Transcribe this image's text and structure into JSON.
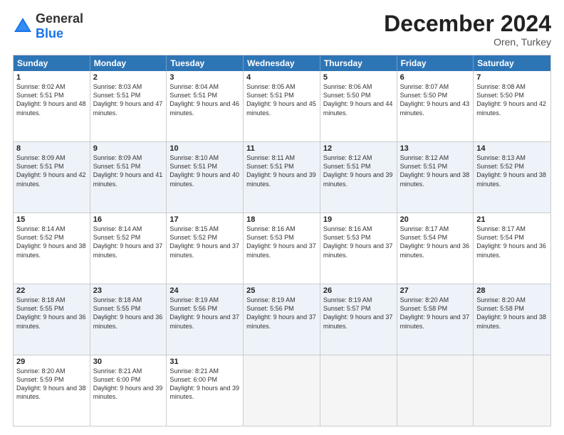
{
  "header": {
    "logo": {
      "general": "General",
      "blue": "Blue"
    },
    "title": "December 2024",
    "subtitle": "Oren, Turkey"
  },
  "days": [
    "Sunday",
    "Monday",
    "Tuesday",
    "Wednesday",
    "Thursday",
    "Friday",
    "Saturday"
  ],
  "weeks": [
    [
      {
        "day": "1",
        "rise": "8:02 AM",
        "set": "5:51 PM",
        "hours": "9 hours and 48 minutes."
      },
      {
        "day": "2",
        "rise": "8:03 AM",
        "set": "5:51 PM",
        "hours": "9 hours and 47 minutes."
      },
      {
        "day": "3",
        "rise": "8:04 AM",
        "set": "5:51 PM",
        "hours": "9 hours and 46 minutes."
      },
      {
        "day": "4",
        "rise": "8:05 AM",
        "set": "5:51 PM",
        "hours": "9 hours and 45 minutes."
      },
      {
        "day": "5",
        "rise": "8:06 AM",
        "set": "5:50 PM",
        "hours": "9 hours and 44 minutes."
      },
      {
        "day": "6",
        "rise": "8:07 AM",
        "set": "5:50 PM",
        "hours": "9 hours and 43 minutes."
      },
      {
        "day": "7",
        "rise": "8:08 AM",
        "set": "5:50 PM",
        "hours": "9 hours and 42 minutes."
      }
    ],
    [
      {
        "day": "8",
        "rise": "8:09 AM",
        "set": "5:51 PM",
        "hours": "9 hours and 42 minutes."
      },
      {
        "day": "9",
        "rise": "8:09 AM",
        "set": "5:51 PM",
        "hours": "9 hours and 41 minutes."
      },
      {
        "day": "10",
        "rise": "8:10 AM",
        "set": "5:51 PM",
        "hours": "9 hours and 40 minutes."
      },
      {
        "day": "11",
        "rise": "8:11 AM",
        "set": "5:51 PM",
        "hours": "9 hours and 39 minutes."
      },
      {
        "day": "12",
        "rise": "8:12 AM",
        "set": "5:51 PM",
        "hours": "9 hours and 39 minutes."
      },
      {
        "day": "13",
        "rise": "8:12 AM",
        "set": "5:51 PM",
        "hours": "9 hours and 38 minutes."
      },
      {
        "day": "14",
        "rise": "8:13 AM",
        "set": "5:52 PM",
        "hours": "9 hours and 38 minutes."
      }
    ],
    [
      {
        "day": "15",
        "rise": "8:14 AM",
        "set": "5:52 PM",
        "hours": "9 hours and 38 minutes."
      },
      {
        "day": "16",
        "rise": "8:14 AM",
        "set": "5:52 PM",
        "hours": "9 hours and 37 minutes."
      },
      {
        "day": "17",
        "rise": "8:15 AM",
        "set": "5:52 PM",
        "hours": "9 hours and 37 minutes."
      },
      {
        "day": "18",
        "rise": "8:16 AM",
        "set": "5:53 PM",
        "hours": "9 hours and 37 minutes."
      },
      {
        "day": "19",
        "rise": "8:16 AM",
        "set": "5:53 PM",
        "hours": "9 hours and 37 minutes."
      },
      {
        "day": "20",
        "rise": "8:17 AM",
        "set": "5:54 PM",
        "hours": "9 hours and 36 minutes."
      },
      {
        "day": "21",
        "rise": "8:17 AM",
        "set": "5:54 PM",
        "hours": "9 hours and 36 minutes."
      }
    ],
    [
      {
        "day": "22",
        "rise": "8:18 AM",
        "set": "5:55 PM",
        "hours": "9 hours and 36 minutes."
      },
      {
        "day": "23",
        "rise": "8:18 AM",
        "set": "5:55 PM",
        "hours": "9 hours and 36 minutes."
      },
      {
        "day": "24",
        "rise": "8:19 AM",
        "set": "5:56 PM",
        "hours": "9 hours and 37 minutes."
      },
      {
        "day": "25",
        "rise": "8:19 AM",
        "set": "5:56 PM",
        "hours": "9 hours and 37 minutes."
      },
      {
        "day": "26",
        "rise": "8:19 AM",
        "set": "5:57 PM",
        "hours": "9 hours and 37 minutes."
      },
      {
        "day": "27",
        "rise": "8:20 AM",
        "set": "5:58 PM",
        "hours": "9 hours and 37 minutes."
      },
      {
        "day": "28",
        "rise": "8:20 AM",
        "set": "5:58 PM",
        "hours": "9 hours and 38 minutes."
      }
    ],
    [
      {
        "day": "29",
        "rise": "8:20 AM",
        "set": "5:59 PM",
        "hours": "9 hours and 38 minutes."
      },
      {
        "day": "30",
        "rise": "8:21 AM",
        "set": "6:00 PM",
        "hours": "9 hours and 39 minutes."
      },
      {
        "day": "31",
        "rise": "8:21 AM",
        "set": "6:00 PM",
        "hours": "9 hours and 39 minutes."
      },
      null,
      null,
      null,
      null
    ]
  ]
}
